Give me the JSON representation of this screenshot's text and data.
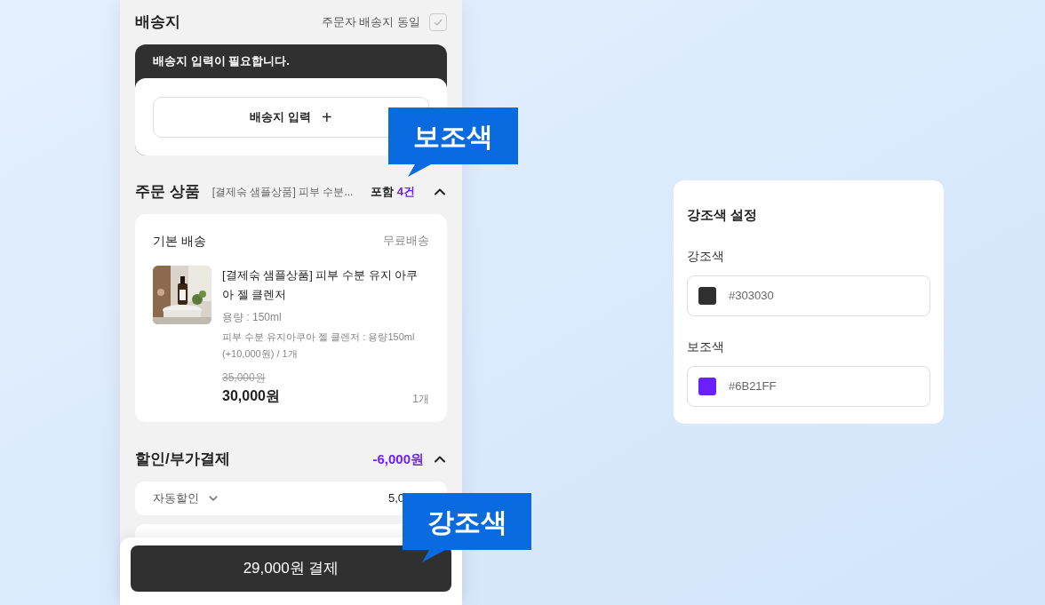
{
  "shipping": {
    "title": "배송지",
    "same_as_orderer": {
      "label": "주문자 배송지 동일",
      "checked": false
    },
    "notice": "배송지 입력이 필요합니다.",
    "add_button": "배송지 입력",
    "add_icon": "+"
  },
  "order": {
    "title": "주문 상품",
    "summary": "[결제숚 샘플상품] 피부 수분...",
    "include": "포함",
    "count": "4건",
    "expanded": true,
    "group": {
      "title": "기본 배송",
      "fee": "무료배송",
      "item": {
        "kind": "picture",
        "name": "[결제숚 샘플상품] 피부 수분 유지 아쿠아 젤 클렌저",
        "option": "용량 : 150ml",
        "detail": "피부 수분 유지아쿠아 젤 클렌저 : 용량150ml (+10,000원) / 1개",
        "original_price": "35,000원",
        "price": "30,000원",
        "quantity": "1개"
      }
    }
  },
  "discount": {
    "title": "할인/부가결제",
    "total": "-6,000원",
    "expanded": true,
    "rows": [
      {
        "label": "자동할인",
        "value": "5,0"
      }
    ]
  },
  "pay_button": "29,000원 결제",
  "callouts": [
    {
      "label": "보조색"
    },
    {
      "label": "강조색"
    }
  ],
  "settings": {
    "title": "강조색 설정",
    "fields": [
      {
        "label": "강조색",
        "value": "#303030",
        "color": "#303030"
      },
      {
        "label": "보조색",
        "value": "#6B21FF",
        "color": "#6b21ff"
      }
    ]
  }
}
